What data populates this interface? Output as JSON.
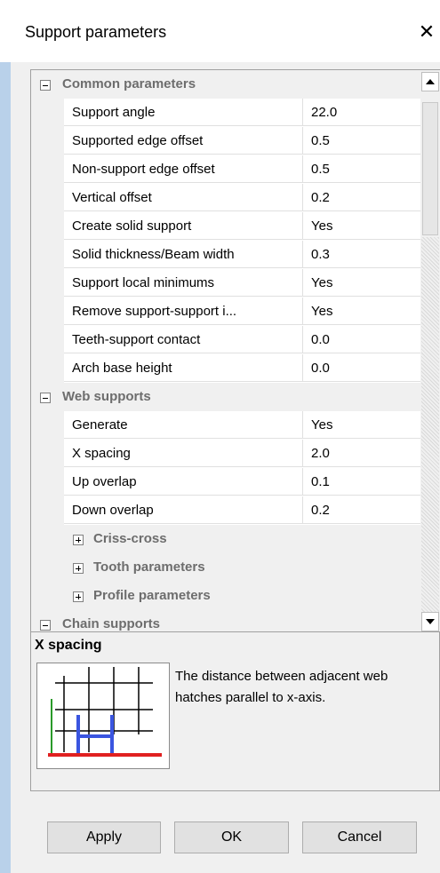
{
  "window": {
    "title": "Support parameters",
    "close_glyph": "✕"
  },
  "grid": {
    "categories": [
      {
        "label": "Common parameters",
        "expander": "minus",
        "rows": [
          {
            "name": "Support angle",
            "value": "22.0"
          },
          {
            "name": "Supported edge offset",
            "value": "0.5"
          },
          {
            "name": "Non-support edge offset",
            "value": "0.5"
          },
          {
            "name": "Vertical offset",
            "value": "0.2"
          },
          {
            "name": "Create solid support",
            "value": "Yes"
          },
          {
            "name": "Solid thickness/Beam width",
            "value": "0.3"
          },
          {
            "name": "Support local minimums",
            "value": "Yes"
          },
          {
            "name": "Remove support-support i...",
            "value": "Yes"
          },
          {
            "name": "Teeth-support contact",
            "value": "0.0"
          },
          {
            "name": "Arch base height",
            "value": "0.0"
          }
        ]
      },
      {
        "label": "Web supports",
        "expander": "minus",
        "rows": [
          {
            "name": "Generate",
            "value": "Yes"
          },
          {
            "name": "X spacing",
            "value": "2.0"
          },
          {
            "name": "Up overlap",
            "value": "0.1"
          },
          {
            "name": "Down overlap",
            "value": "0.2"
          }
        ],
        "subcategories": [
          {
            "label": "Criss-cross",
            "expander": "plus"
          },
          {
            "label": "Tooth parameters",
            "expander": "plus"
          },
          {
            "label": "Profile parameters",
            "expander": "plus"
          }
        ]
      },
      {
        "label": "Chain supports",
        "expander": "minus"
      }
    ]
  },
  "scrollbar": {
    "up_icon": "scroll-up-arrow-icon",
    "down_icon": "scroll-down-arrow-icon"
  },
  "help": {
    "title": "X spacing",
    "description": "The distance between adjacent web hatches parallel to x-axis.",
    "illustration_icon": "web-hatch-diagram-icon"
  },
  "buttons": {
    "apply": "Apply",
    "ok": "OK",
    "cancel": "Cancel"
  },
  "colors": {
    "frame": "#b9d1ea",
    "dialog_bg": "#f0f0f0",
    "category_text": "#6d6d6d",
    "diagram_blue": "#3a55e0",
    "diagram_red": "#e02020",
    "diagram_green": "#2a9a2a"
  }
}
